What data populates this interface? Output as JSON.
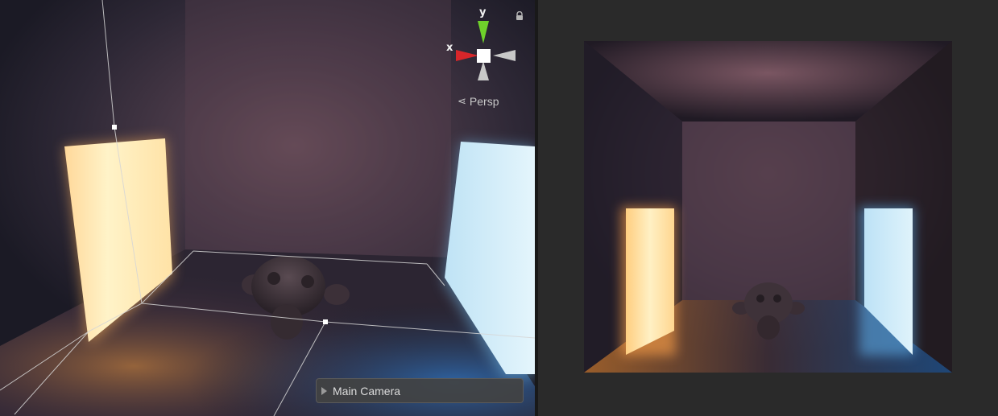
{
  "scene_view": {
    "gizmo": {
      "y_label": "y",
      "x_label": "x",
      "colors": {
        "y": "#6fd12b",
        "x": "#d8262a",
        "neutral": "#c8c8c8",
        "center": "#ffffff"
      }
    },
    "lock_icon": "lock-icon",
    "projection_label": "Persp",
    "projection_icon": "perspective-icon",
    "overlay": {
      "title": "Main Camera",
      "expand_icon": "triangle-right-icon"
    },
    "colors": {
      "warm_light": "#ffe7b0",
      "cool_light": "#cfeaf7",
      "selection_lines": "#d6d6d6"
    }
  },
  "game_view": {
    "background": "#2a2a2a"
  }
}
